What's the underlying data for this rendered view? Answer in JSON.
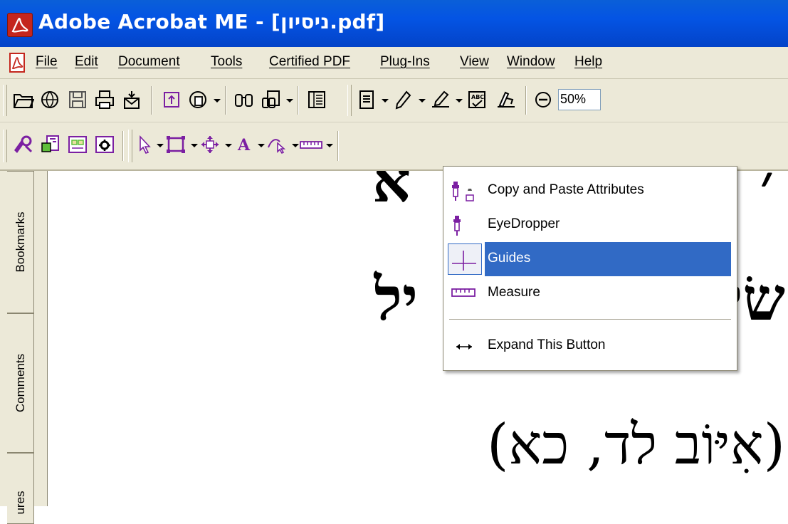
{
  "window": {
    "title": "Adobe Acrobat ME - [ניסיון.pdf]",
    "app_icon": "acrobat-icon"
  },
  "menubar": {
    "doc_icon": "pdf-document-icon",
    "items": [
      "File",
      "Edit",
      "Document",
      "Tools",
      "Certified PDF",
      "Plug-Ins",
      "View",
      "Window",
      "Help"
    ]
  },
  "toolbar1": {
    "zoom_value": "50%",
    "icons": [
      "open-icon",
      "web-icon",
      "save-icon",
      "print-icon",
      "email-icon",
      "upload-icon",
      "create-pdf-icon",
      "search-icon",
      "find-icon",
      "navigation-pane-icon",
      "document-icon",
      "pencil-icon",
      "sign-icon",
      "spellcheck-icon",
      "review-icon",
      "zoom-out-icon"
    ]
  },
  "toolbar2": {
    "icons": [
      "review-tracker-icon",
      "form-icon",
      "checkbox-icon",
      "gear-form-icon",
      "select-arrow-icon",
      "rectangle-icon",
      "move-icon",
      "text-icon",
      "touchup-icon",
      "measure-ruler-icon"
    ]
  },
  "left_panel": {
    "tabs": [
      "Bookmarks",
      "Comments",
      "ures"
    ]
  },
  "document": {
    "line1": "א",
    "line1_right": "׳",
    "line2": "יל",
    "line2_right": "שׂי",
    "line3": "(אִיּוֹב לד, כא)"
  },
  "dropdown": {
    "items": [
      {
        "label": "Copy and Paste Attributes",
        "icon": "copy-paste-attributes-icon"
      },
      {
        "label": "EyeDropper",
        "icon": "eyedropper-icon"
      },
      {
        "label": "Guides",
        "icon": "guides-icon",
        "highlighted": true
      },
      {
        "label": "Measure",
        "icon": "measure-icon"
      },
      {
        "label": "Expand This Button",
        "icon": "expand-arrows-icon"
      }
    ]
  },
  "colors": {
    "titlebar": "#0454e4",
    "chrome": "#ece9d8",
    "highlight": "#316ac5",
    "icon_accent": "#7b1fa2"
  }
}
